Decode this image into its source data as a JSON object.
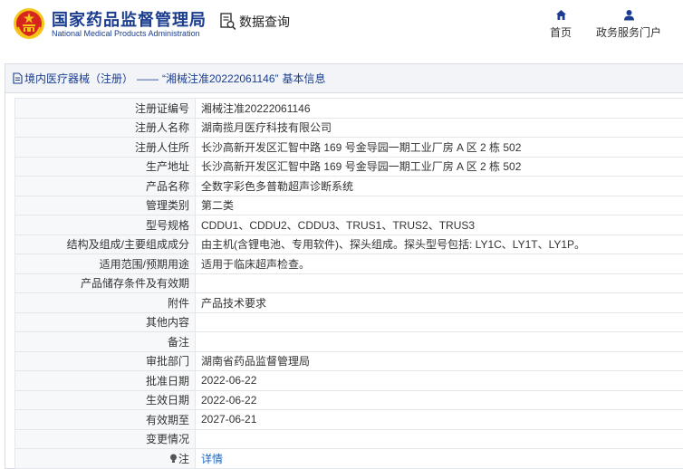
{
  "header": {
    "org_name_cn": "国家药品监督管理局",
    "org_name_en": "National Medical Products Administration",
    "query_label": "数据查询",
    "nav": [
      {
        "label": "首页",
        "icon": "home-icon"
      },
      {
        "label": "政务服务门户",
        "icon": "user-icon"
      }
    ]
  },
  "section": {
    "category": "境内医疗器械（注册）",
    "separator": "——",
    "reg_quoted": "“湘械注准20222061146”",
    "suffix": "基本信息"
  },
  "rows": [
    {
      "label": "注册证编号",
      "value": "湘械注准20222061146"
    },
    {
      "label": "注册人名称",
      "value": "湖南揽月医疗科技有限公司"
    },
    {
      "label": "注册人住所",
      "value": "长沙高新开发区汇智中路 169 号金导园一期工业厂房 A 区 2 栋 502"
    },
    {
      "label": "生产地址",
      "value": "长沙高新开发区汇智中路 169 号金导园一期工业厂房 A 区 2 栋 502"
    },
    {
      "label": "产品名称",
      "value": "全数字彩色多普勒超声诊断系统"
    },
    {
      "label": "管理类别",
      "value": "第二类"
    },
    {
      "label": "型号规格",
      "value": "CDDU1、CDDU2、CDDU3、TRUS1、TRUS2、TRUS3"
    },
    {
      "label": "结构及组成/主要组成成分",
      "value": "由主机(含锂电池、专用软件)、探头组成。探头型号包括: LY1C、LY1T、LY1P。"
    },
    {
      "label": "适用范围/预期用途",
      "value": "适用于临床超声检查。"
    },
    {
      "label": "产品储存条件及有效期",
      "value": ""
    },
    {
      "label": "附件",
      "value": "产品技术要求"
    },
    {
      "label": "其他内容",
      "value": ""
    },
    {
      "label": "备注",
      "value": ""
    },
    {
      "label": "审批部门",
      "value": "湖南省药品监督管理局"
    },
    {
      "label": "批准日期",
      "value": "2022-06-22"
    },
    {
      "label": "生效日期",
      "value": "2022-06-22"
    },
    {
      "label": "有效期至",
      "value": "2027-06-21"
    },
    {
      "label": "变更情况",
      "value": ""
    }
  ],
  "note_row": {
    "label": "注",
    "icon": "lightbulb-icon",
    "link": "详情"
  },
  "colors": {
    "brand_blue": "#1a3d8f",
    "link_blue": "#1a66c2",
    "emblem_red": "#d7261e",
    "emblem_gold": "#f5c518"
  }
}
